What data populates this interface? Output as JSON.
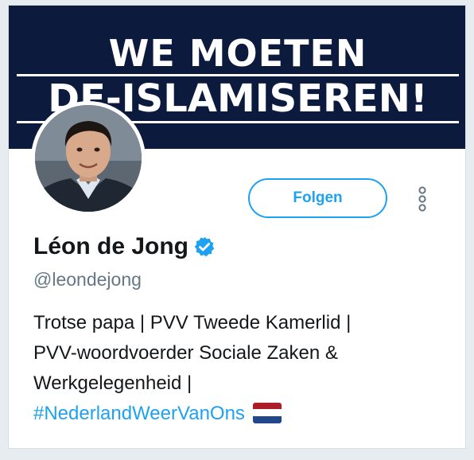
{
  "banner": {
    "line1": "WE MOETEN",
    "line2": "DE-ISLAMISEREN!"
  },
  "profile": {
    "display_name": "Léon de Jong",
    "handle": "@leondejong",
    "verified": true
  },
  "actions": {
    "follow_label": "Folgen",
    "more_icon": "vertical-ellipsis-icon"
  },
  "bio": {
    "line1": "Trotse papa | PVV Tweede Kamerlid |",
    "line2": "PVV-woordvoerder Sociale Zaken &",
    "line3": "Werkgelegenheid |",
    "hashtag": "#NederlandWeerVanOns",
    "flag_icon": "netherlands-flag-icon"
  },
  "colors": {
    "accent": "#1da1f2",
    "banner_bg": "#0c1a3e",
    "flag_red": "#ae1c28",
    "flag_white": "#ffffff",
    "flag_blue": "#21468b"
  }
}
